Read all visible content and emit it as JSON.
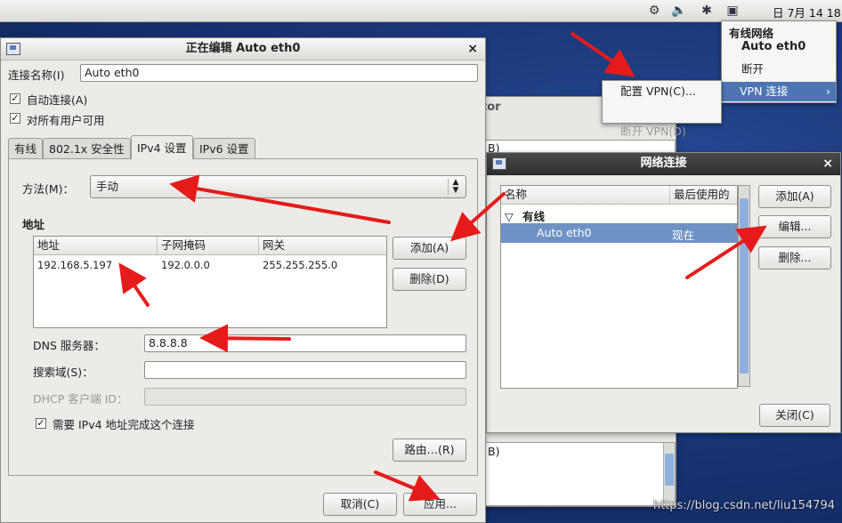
{
  "topbar": {
    "clock": "日 7月 14 18"
  },
  "tray_menu": {
    "section": "有线网络",
    "connection": "Auto eth0",
    "disconnect": "断开",
    "vpn": "VPN 连接",
    "submenu_arrow": "›"
  },
  "vpn_menu": {
    "configure": "配置 VPN(C)...",
    "disconnect": "断开 VPN(D)"
  },
  "editor": {
    "title": "正在编辑 Auto eth0",
    "close": "×",
    "name_label": "连接名称(I)",
    "name_value": "Auto eth0",
    "auto_connect": "自动连接(A)",
    "all_users": "对所有用户可用",
    "tabs": [
      "有线",
      "802.1x 安全性",
      "IPv4 设置",
      "IPv6 设置"
    ],
    "method_label": "方法(M)：",
    "method_value": "手动",
    "address_heading": "地址",
    "table_headers": [
      "地址",
      "子网掩码",
      "网关"
    ],
    "rows": [
      [
        "192.168.5.197",
        "192.0.0.0",
        "255.255.255.0"
      ]
    ],
    "add_button": "添加(A)",
    "delete_button": "删除(D)",
    "dns_label": "DNS 服务器：",
    "dns_value": "8.8.8.8",
    "search_label": "搜索域(S)：",
    "search_value": "",
    "dhcp_label": "DHCP 客户端 ID：",
    "dhcp_value": "",
    "require_ipv4": "需要 IPv4 地址完成这个连接",
    "routes_button": "路由…(R)",
    "cancel_button": "取消(C)",
    "apply_button": "应用..."
  },
  "bg_window": {
    "title_fragment": "tor",
    "text_1": "B)",
    "text_2": "B)"
  },
  "netconn": {
    "title": "网络连接",
    "close": "×",
    "col_name": "名称",
    "col_last_used": "最后使用的",
    "group": "有线",
    "group_toggle": "▽",
    "item_name": "Auto eth0",
    "item_last_used": "现在",
    "add_button": "添加(A)",
    "edit_button": "编辑...",
    "delete_button": "删除...",
    "close_button": "关闭(C)"
  },
  "watermark": "https://blog.csdn.net/liu154794"
}
